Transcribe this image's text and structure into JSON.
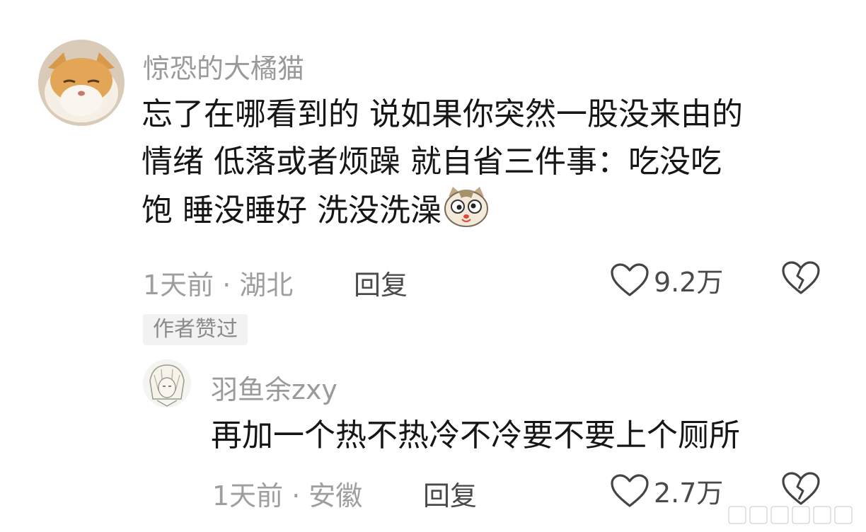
{
  "comment": {
    "username": "惊恐的大橘猫",
    "text_line1": "忘了在哪看到的 说如果你突然一股没来由的",
    "text_line2": "情绪 低落或者烦躁 就自省三件事：吃没吃",
    "text_line3": "饱 睡没睡好 洗没洗澡",
    "time": "1天前",
    "location": "湖北",
    "reply_label": "回复",
    "likes": "9.2万",
    "badge": "作者赞过"
  },
  "reply": {
    "username": "羽鱼余zxy",
    "text": "再加一个热不热冷不冷要不要上个厕所",
    "time": "1天前",
    "location": "安徽",
    "reply_label": "回复",
    "likes": "2.7万"
  },
  "separator": "·",
  "icons": {
    "avatar_main": "cat-avatar",
    "avatar_reply": "anime-avatar",
    "emoji": "cat-face-emoji",
    "like": "heart-outline-icon",
    "dislike": "broken-heart-icon"
  },
  "colors": {
    "username": "#9a9a9a",
    "meta": "#9e9e9e",
    "badge_bg": "#f2f2f2"
  }
}
